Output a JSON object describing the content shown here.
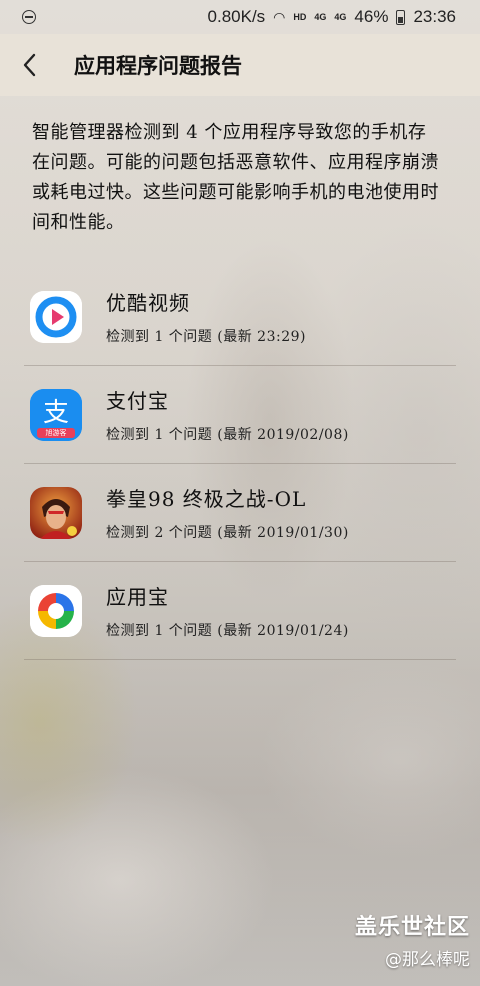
{
  "status_bar": {
    "speed": "0.80K/s",
    "hd_label": "HD",
    "net1": "4G",
    "net2": "4G",
    "battery": "46%",
    "time": "23:36"
  },
  "header": {
    "back_icon": "chevron-left-icon",
    "title": "应用程序问题报告"
  },
  "description": "智能管理器检测到 4 个应用程序导致您的手机存在问题。可能的问题包括恶意软件、应用程序崩溃或耗电过快。这些问题可能影响手机的电池使用时间和性能。",
  "apps": [
    {
      "name": "优酷视频",
      "detail": "检测到 1 个问题 (最新 23:29)",
      "icon": "youku-icon"
    },
    {
      "name": "支付宝",
      "detail": "检测到 1 个问题 (最新 2019/02/08)",
      "icon": "alipay-icon"
    },
    {
      "name": "拳皇98 终极之战-OL",
      "detail": "检测到 2 个问题 (最新 2019/01/30)",
      "icon": "kof98-icon"
    },
    {
      "name": "应用宝",
      "detail": "检测到 1 个问题 (最新 2019/01/24)",
      "icon": "yingyongbao-icon"
    }
  ],
  "alipay_badge": "旭游客",
  "watermark": {
    "line1": "盖乐世社区",
    "line2": "@那么棒呢"
  },
  "colors": {
    "header_bg": "#e8e2d8",
    "youku_blue": "#1e8ff2",
    "alipay_blue": "#1a8df0",
    "yingyongbao_blue": "#2b74e8"
  }
}
